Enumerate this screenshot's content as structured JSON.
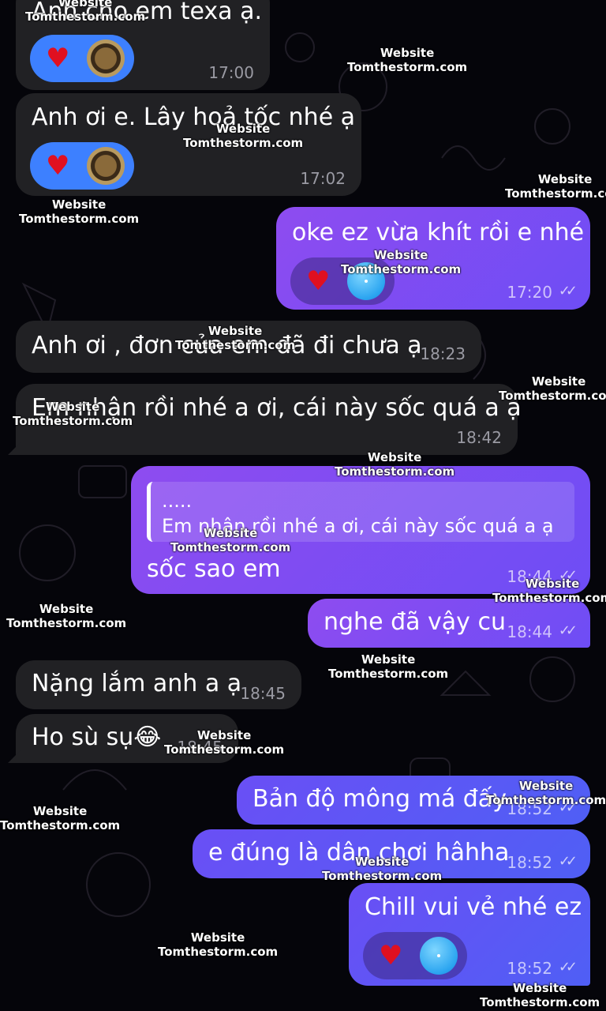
{
  "messages": [
    {
      "id": "m1",
      "dir": "in",
      "text": "Anh cho em texa ạ.",
      "time": "17:00",
      "reaction": "heart"
    },
    {
      "id": "m2",
      "dir": "in",
      "text": "Anh ơi e. Lây hoả tốc nhé ạ",
      "time": "17:02",
      "reaction": "heart"
    },
    {
      "id": "m3",
      "dir": "out",
      "text": "oke ez vừa khít rồi e nhé",
      "time": "17:20",
      "reaction": "heart"
    },
    {
      "id": "m4",
      "dir": "in",
      "text": "Anh ơi , đơn của em đã đi chưa ạ",
      "time": "18:23"
    },
    {
      "id": "m5",
      "dir": "in",
      "text": "Em nhận rồi nhé a ơi, cái này sốc quá a ạ",
      "time": "18:42"
    },
    {
      "id": "m6",
      "dir": "out",
      "quote_title": ".....",
      "quote_text": "Em nhận rồi nhé a ơi, cái này sốc quá a ạ",
      "text": "sốc sao em",
      "time": "18:44"
    },
    {
      "id": "m7",
      "dir": "out",
      "text": "nghe đã vậy cu",
      "time": "18:44"
    },
    {
      "id": "m8",
      "dir": "in",
      "text": "Nặng lắm anh a ạ",
      "time": "18:45"
    },
    {
      "id": "m9",
      "dir": "in",
      "text": "Ho sù sụ😂",
      "time": "18:45"
    },
    {
      "id": "m10",
      "dir": "out",
      "text": "Bản độ mông má đấy",
      "time": "18:52"
    },
    {
      "id": "m11",
      "dir": "out",
      "text": "e đúng là dân chơi hâhha",
      "time": "18:52"
    },
    {
      "id": "m12",
      "dir": "out",
      "text": "Chill vui vẻ nhé ez",
      "time": "18:52",
      "reaction": "heart"
    }
  ],
  "watermark": {
    "line1": "Website",
    "line2": "Tomthestorm.com"
  },
  "icons": {
    "heart": "♥",
    "double_check": "✓✓"
  },
  "colors": {
    "background": "#05050a",
    "incoming": "#212124",
    "outgoing_purple": "#8e4cf0",
    "outgoing_blue": "#5b5ef5",
    "heart": "#e01020",
    "reaction_blue": "#3d80ff"
  }
}
